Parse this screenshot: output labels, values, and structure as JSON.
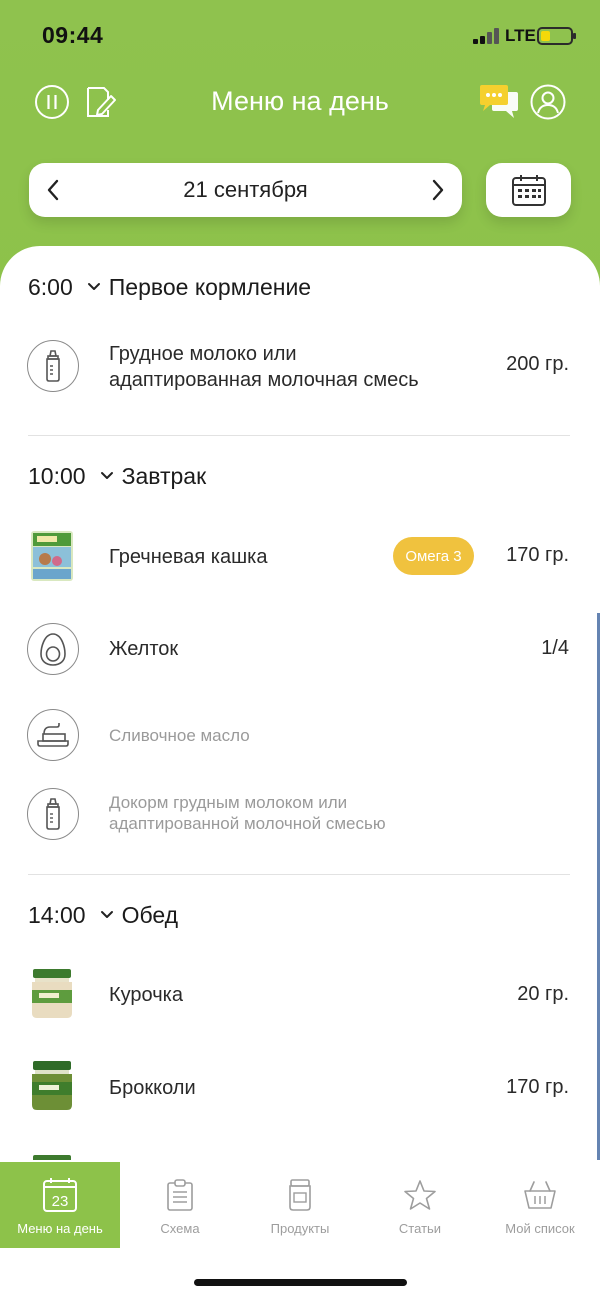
{
  "status_bar": {
    "time": "09:44",
    "network": "LTE"
  },
  "header": {
    "title": "Меню на день",
    "icons": [
      "pause-icon",
      "edit-icon",
      "chat-icon",
      "profile-icon"
    ]
  },
  "date_nav": {
    "date": "21 сентября"
  },
  "sections": [
    {
      "time": "6:00",
      "name": "Первое кормление",
      "items": [
        {
          "icon": "bottle-icon",
          "name": "Грудное молоко или\nадаптированная молочная смесь",
          "amount": "200 гр."
        }
      ]
    },
    {
      "time": "10:00",
      "name": "Завтрак",
      "items": [
        {
          "icon": "cereal-box-image",
          "name": "Гречневая кашка",
          "badge": "Омега 3",
          "amount": "170 гр."
        },
        {
          "icon": "egg-icon",
          "name": "Желток",
          "amount": "1/4"
        },
        {
          "icon": "butter-icon",
          "name": "Сливочное масло",
          "amount": ""
        },
        {
          "icon": "bottle-icon",
          "name": "Докорм грудным молоком или\nадаптированной молочной смесью",
          "amount": ""
        }
      ]
    },
    {
      "time": "14:00",
      "name": "Обед",
      "items": [
        {
          "icon": "baby-food-jar-image",
          "name": "Курочка",
          "amount": "20 гр."
        },
        {
          "icon": "baby-food-jar-image",
          "name": "Брокколи",
          "amount": "170 гр."
        }
      ]
    }
  ],
  "tabs": [
    {
      "label": "Меню на день",
      "icon": "calendar-day-icon",
      "day": "23",
      "active": true
    },
    {
      "label": "Схема",
      "icon": "clipboard-icon",
      "active": false
    },
    {
      "label": "Продукты",
      "icon": "jar-icon",
      "active": false
    },
    {
      "label": "Статьи",
      "icon": "star-icon",
      "active": false
    },
    {
      "label": "Мой список",
      "icon": "basket-icon",
      "active": false
    }
  ],
  "colors": {
    "brand_green": "#8dc24a",
    "badge_yellow": "#f0c23e",
    "chat_icon": "#f5d02e"
  }
}
